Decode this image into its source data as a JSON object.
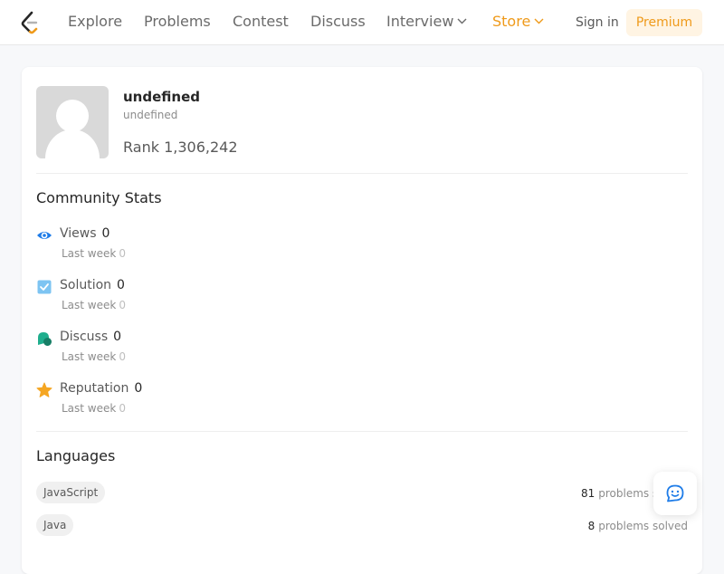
{
  "nav": {
    "links": [
      "Explore",
      "Problems",
      "Contest",
      "Discuss",
      "Interview",
      "Store"
    ],
    "sign_in": "Sign in",
    "premium": "Premium",
    "accent_color": "#ef9a1a"
  },
  "profile": {
    "name": "undefined",
    "username": "undefined",
    "rank_label": "Rank",
    "rank_value": "1,306,242"
  },
  "community_stats": {
    "title": "Community Stats",
    "items": [
      {
        "icon": "eye-icon",
        "label": "Views",
        "value": "0",
        "sub_label": "Last week",
        "sub_value": "0"
      },
      {
        "icon": "check-square-icon",
        "label": "Solution",
        "value": "0",
        "sub_label": "Last week",
        "sub_value": "0"
      },
      {
        "icon": "chat-bubbles-icon",
        "label": "Discuss",
        "value": "0",
        "sub_label": "Last week",
        "sub_value": "0"
      },
      {
        "icon": "star-icon",
        "label": "Reputation",
        "value": "0",
        "sub_label": "Last week",
        "sub_value": "0"
      }
    ]
  },
  "languages": {
    "title": "Languages",
    "items": [
      {
        "name": "JavaScript",
        "count": "81",
        "suffix": "problems solved"
      },
      {
        "name": "Java",
        "count": "8",
        "suffix": "problems solved"
      }
    ]
  }
}
